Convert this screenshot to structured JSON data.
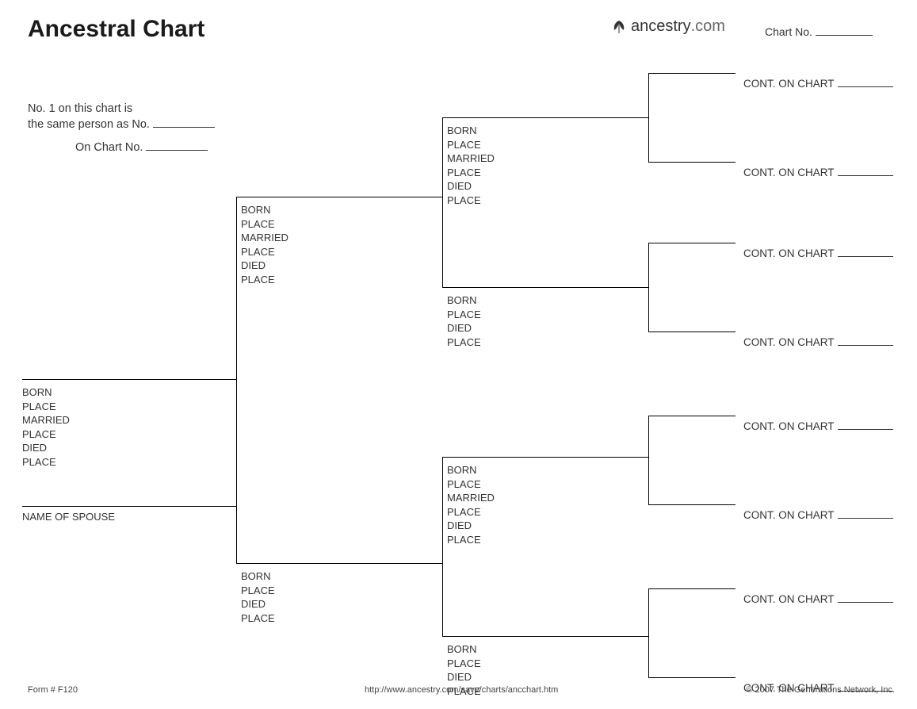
{
  "title": "Ancestral Chart",
  "brand": {
    "part1": "ancestry",
    "part2": ".com"
  },
  "chart_no_label": "Chart No.",
  "intro": {
    "line1": "No. 1 on this chart is",
    "line2_prefix": "the same person as No.",
    "line3_prefix": "On Chart No."
  },
  "fields_full": {
    "born": "BORN",
    "place1": "PLACE",
    "married": "MARRIED",
    "place2": "PLACE",
    "died": "DIED",
    "place3": "PLACE"
  },
  "fields_short": {
    "born": "BORN",
    "place1": "PLACE",
    "died": "DIED",
    "place2": "PLACE"
  },
  "spouse_label": "NAME OF SPOUSE",
  "cont_label": "CONT. ON CHART",
  "footer": {
    "form": "Form # F120",
    "url": "http://www.ancestry.com/save/charts/ancchart.htm",
    "copyright": "© 2007 The Generations Network, Inc."
  }
}
